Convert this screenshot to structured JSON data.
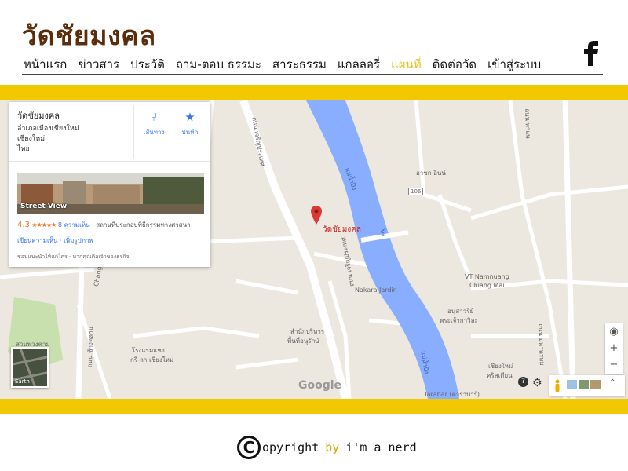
{
  "site": {
    "title": "วัดชัยมงคล"
  },
  "nav": {
    "items": [
      {
        "label": "หน้าแรก",
        "active": false
      },
      {
        "label": "ข่าวสาร",
        "active": false
      },
      {
        "label": "ประวัติ",
        "active": false
      },
      {
        "label": "ถาม-ตอบ ธรรมะ",
        "active": false
      },
      {
        "label": "สาระธรรม",
        "active": false
      },
      {
        "label": "แกลลอรี่",
        "active": false
      },
      {
        "label": "แผนที่",
        "active": true
      },
      {
        "label": "ติดต่อวัด",
        "active": false
      },
      {
        "label": "เข้าสู่ระบบ",
        "active": false
      }
    ],
    "active_color": "#e8c31a",
    "social_icon": "facebook-icon"
  },
  "colors": {
    "title": "#5a2d0c",
    "band": "#f2c800",
    "river": "#8aaeff",
    "pin": "#db3a34"
  },
  "map": {
    "info_card": {
      "name": "วัดชัยมงคล",
      "address_lines": [
        "อำเภอเมืองเชียงใหม่",
        "เชียงใหม่",
        "ไทย"
      ],
      "directions_label": "เส้นทาง",
      "save_label": "บันทึก",
      "street_view_label": "Street View",
      "rating": "4.3",
      "stars": "★★★★★",
      "reviews_label": "8 ความเห็น",
      "category": "· สถานที่ประกอบพิธีกรรมทางศาสนา",
      "write_links": "เขียนความเห็น · เพิ่มรูปภาพ",
      "hint": "ชอบแนะนำให้แก่ใคร · หากคุณคือเจ้าของธุรกิจ"
    },
    "pin_label": "วัดชัยมงคล",
    "labels": [
      {
        "text": "ถนน เจริญประเทศ",
        "name": "road-label-charoenprathet-north"
      },
      {
        "text": "แม่น้ำปิง",
        "name": "river-label-north"
      },
      {
        "text": "ปิง",
        "name": "river-label-mid"
      },
      {
        "text": "แม่น้ำปิง",
        "name": "river-label-south"
      },
      {
        "text": "Nakara Jardin",
        "name": "place-label-nakara"
      },
      {
        "text": "VT Namnuang",
        "name": "place-label-vt-1"
      },
      {
        "text": "Chiang Mai",
        "name": "place-label-vt-2"
      },
      {
        "text": "Chang Klan",
        "name": "road-label-chang-klan"
      },
      {
        "text": "ถนน ช้างคลาน",
        "name": "road-label-chang-klan-th"
      },
      {
        "text": "สำนักบริหาร",
        "name": "place-label-office-1"
      },
      {
        "text": "พื้นที่อนุรักษ์",
        "name": "place-label-office-2"
      },
      {
        "text": "โรงแรมแชง",
        "name": "place-label-hotel-1"
      },
      {
        "text": "กรี-ลา เชียงใหม่",
        "name": "place-label-hotel-2"
      },
      {
        "text": "สวนพวงคาม",
        "name": "place-label-park"
      },
      {
        "text": "อาชก อินน์",
        "name": "place-label-inn"
      },
      {
        "text": "อนุสาวรีย์",
        "name": "place-label-monument-1"
      },
      {
        "text": "พระเจ้ากาวิละ",
        "name": "place-label-monument-2"
      },
      {
        "text": "เชียงใหม่",
        "name": "place-label-cm-1"
      },
      {
        "text": "คริสเตียน",
        "name": "place-label-cm-2"
      },
      {
        "text": "Tarabar (ตาราบาร์)",
        "name": "place-label-tarabar"
      },
      {
        "text": "ถนน ท่าแพ",
        "name": "road-label-thaphae"
      },
      {
        "text": "ถนน มหาพรหม",
        "name": "road-label-mahaprom"
      },
      {
        "text": "ถนน เจริญประเทศ",
        "name": "road-label-charoenprathet-south"
      },
      {
        "text": "106",
        "name": "route-shield-106"
      }
    ],
    "google_label": "Google",
    "earth_label": "Earth",
    "zoom_in": "+",
    "zoom_out": "−",
    "compass": "◉",
    "expand": "⌃"
  },
  "footer": {
    "c_mark": "C",
    "rest": "opyright",
    "by": "by",
    "author": "i'm a nerd"
  }
}
